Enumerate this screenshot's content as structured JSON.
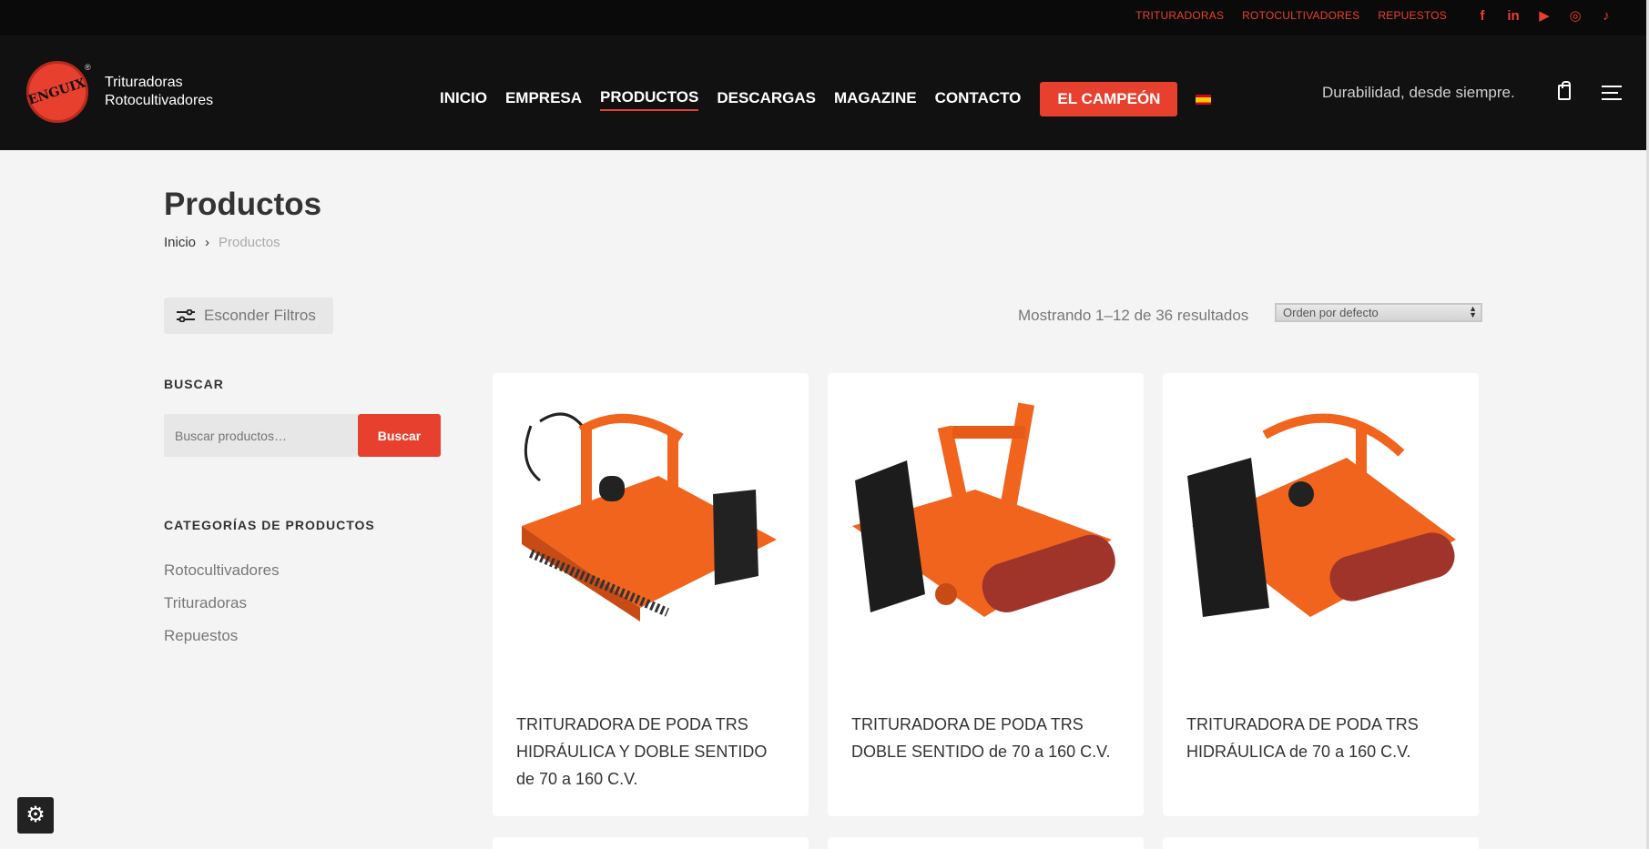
{
  "topbar": {
    "links": [
      "TRITURADORAS",
      "ROTOCULTIVADORES",
      "REPUESTOS"
    ],
    "social": [
      {
        "icon": "facebook-icon",
        "glyph": "f"
      },
      {
        "icon": "linkedin-icon",
        "glyph": "in"
      },
      {
        "icon": "youtube-icon",
        "glyph": "▶"
      },
      {
        "icon": "instagram-icon",
        "glyph": "◎"
      },
      {
        "icon": "tiktok-icon",
        "glyph": "♪"
      }
    ]
  },
  "header": {
    "logo_text": "ENGUIX",
    "logo_reg": "®",
    "brand_line1": "Trituradoras",
    "brand_line2": "Rotocultivadores",
    "nav": [
      "INICIO",
      "EMPRESA",
      "PRODUCTOS",
      "DESCARGAS",
      "MAGAZINE",
      "CONTACTO"
    ],
    "active_nav": "PRODUCTOS",
    "cta": "EL CAMPEÓN",
    "language": "es",
    "tagline": "Durabilidad, desde siempre."
  },
  "page": {
    "title": "Productos",
    "breadcrumb_home": "Inicio",
    "breadcrumb_sep": "›",
    "breadcrumb_current": "Productos"
  },
  "toolbar": {
    "filters_label": "Esconder Filtros",
    "result_count": "Mostrando 1–12 de 36 resultados",
    "orderby_selected": "Orden por defecto"
  },
  "sidebar": {
    "search_heading": "BUSCAR",
    "search_placeholder": "Buscar productos…",
    "search_button": "Buscar",
    "categories_heading": "CATEGORÍAS DE PRODUCTOS",
    "categories": [
      "Rotocultivadores",
      "Trituradoras",
      "Repuestos"
    ]
  },
  "products": [
    {
      "title": "TRITURADORA DE PODA TRS HIDRÁULICA Y DOBLE SENTIDO de 70 a 160 C.V."
    },
    {
      "title": "TRITURADORA DE PODA TRS DOBLE SENTIDO de 70 a 160 C.V."
    },
    {
      "title": "TRITURADORA DE PODA TRS HIDRÁULICA de 70 a 160 C.V."
    }
  ],
  "colors": {
    "accent": "#e8402f",
    "topbar_bg": "#0a0a0a",
    "header_bg": "#111111",
    "page_bg": "#f4f4f4",
    "machine_orange": "#f0641e"
  }
}
